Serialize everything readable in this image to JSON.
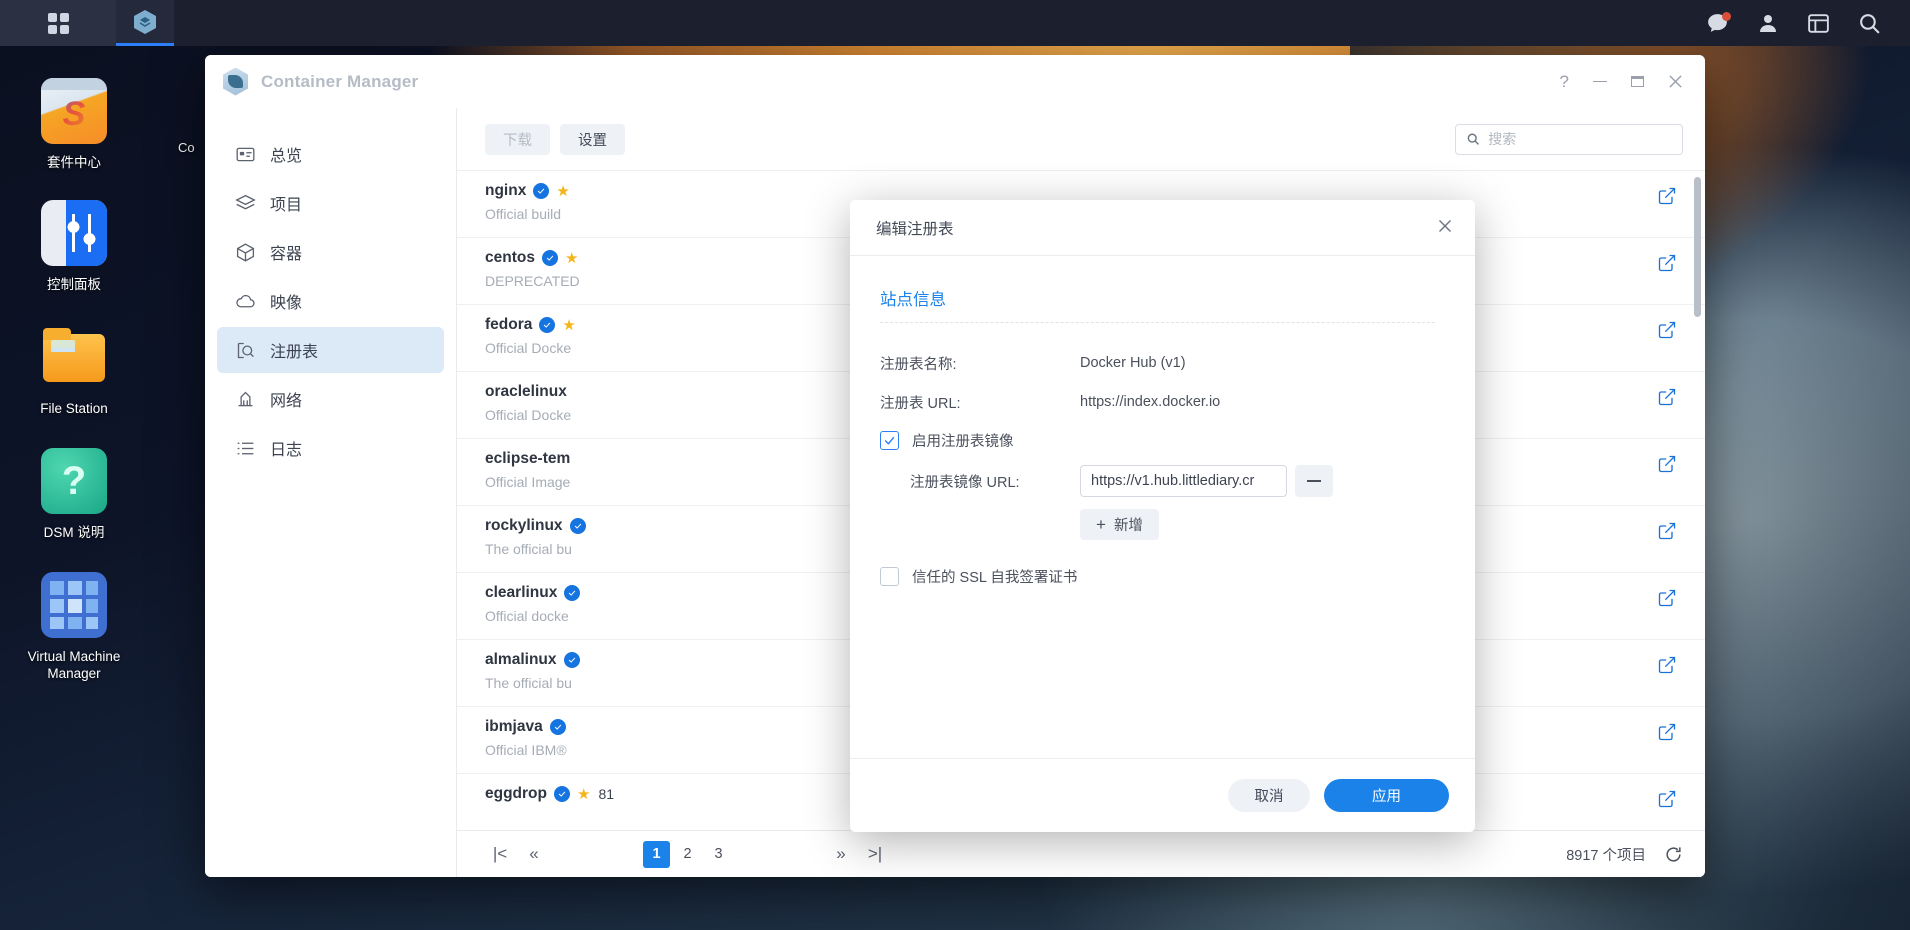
{
  "taskbar": {
    "apps_icon": "grid-icon",
    "active_app_icon": "container-manager-icon",
    "right_icons": [
      "chat-icon",
      "user-icon",
      "widget-icon",
      "search-icon"
    ]
  },
  "desktop_icons": [
    {
      "label": "套件中心",
      "icon": "package-center-icon"
    },
    {
      "label": "控制面板",
      "icon": "control-panel-icon"
    },
    {
      "label": "File Station",
      "icon": "file-station-icon"
    },
    {
      "label": "DSM 说明",
      "icon": "dsm-help-icon"
    },
    {
      "label": "Virtual Machine Manager",
      "icon": "virtual-machine-manager-icon"
    }
  ],
  "desktop_partial_label": "Co",
  "window": {
    "title": "Container Manager",
    "logo_icon": "container-manager-logo",
    "controls": {
      "help": "?",
      "minimize": "minimize-icon",
      "maximize": "maximize-icon",
      "close": "close-icon"
    }
  },
  "sidebar": {
    "items": [
      {
        "label": "总览",
        "icon": "overview-icon",
        "active": false
      },
      {
        "label": "项目",
        "icon": "project-layers-icon",
        "active": false
      },
      {
        "label": "容器",
        "icon": "container-cube-icon",
        "active": false
      },
      {
        "label": "映像",
        "icon": "image-cloud-icon",
        "active": false
      },
      {
        "label": "注册表",
        "icon": "registry-search-icon",
        "active": true
      },
      {
        "label": "网络",
        "icon": "network-icon",
        "active": false
      },
      {
        "label": "日志",
        "icon": "log-list-icon",
        "active": false
      }
    ]
  },
  "toolbar": {
    "download_label": "下载",
    "download_disabled": true,
    "settings_label": "设置"
  },
  "search": {
    "placeholder": "搜索",
    "value": "",
    "icon": "search-icon"
  },
  "image_list": [
    {
      "name": "nginx",
      "verified": true,
      "star": true,
      "stars": "",
      "desc": "Official build"
    },
    {
      "name": "centos",
      "verified": true,
      "star": true,
      "stars": "",
      "desc": "DEPRECATED"
    },
    {
      "name": "fedora",
      "verified": true,
      "star": true,
      "stars": "",
      "desc": "Official Docke"
    },
    {
      "name": "oraclelinux",
      "verified": true,
      "star": false,
      "stars": "",
      "desc": "Official Docke"
    },
    {
      "name": "eclipse-tem",
      "verified": false,
      "star": false,
      "stars": "",
      "desc": "Official Image"
    },
    {
      "name": "rockylinux",
      "verified": true,
      "star": false,
      "stars": "",
      "desc": "The official bu"
    },
    {
      "name": "clearlinux",
      "verified": true,
      "star": false,
      "stars": "",
      "desc": "Official docke"
    },
    {
      "name": "almalinux",
      "verified": true,
      "star": false,
      "stars": "",
      "desc": "The official bu"
    },
    {
      "name": "ibmjava",
      "verified": true,
      "star": false,
      "stars": "",
      "desc": "Official IBM®"
    },
    {
      "name": "eggdrop",
      "verified": true,
      "star": true,
      "stars": "81",
      "desc": ""
    }
  ],
  "pagination": {
    "first_icon": "first-page-icon",
    "prev_icon": "prev-page-icon",
    "pages": [
      "1",
      "2",
      "3"
    ],
    "current_page": "1",
    "next_icon": "next-page-icon",
    "last_icon": "last-page-icon",
    "item_count": "8917 个项目",
    "refresh_icon": "refresh-icon"
  },
  "dialog": {
    "title": "编辑注册表",
    "close_icon": "close-icon",
    "section_title": "站点信息",
    "fields": {
      "registry_name_label": "注册表名称:",
      "registry_name_value": "Docker Hub (v1)",
      "registry_url_label": "注册表 URL:",
      "registry_url_value": "https://index.docker.io"
    },
    "enable_mirror": {
      "label": "启用注册表镜像",
      "checked": true
    },
    "mirror_url": {
      "label": "注册表镜像 URL:",
      "value": "https://v1.hub.littlediary.cr",
      "remove_icon": "minus-icon"
    },
    "add_button_label": "新增",
    "trust_ssl": {
      "label": "信任的 SSL 自我签署证书",
      "checked": false
    },
    "cancel_label": "取消",
    "apply_label": "应用"
  },
  "colors": {
    "accent": "#1a82e8",
    "nav_active_bg": "#dce9f7",
    "verified_blue": "#1574e0",
    "star_yellow": "#f5b51a",
    "taskbar_bg": "#1b1f2e"
  }
}
